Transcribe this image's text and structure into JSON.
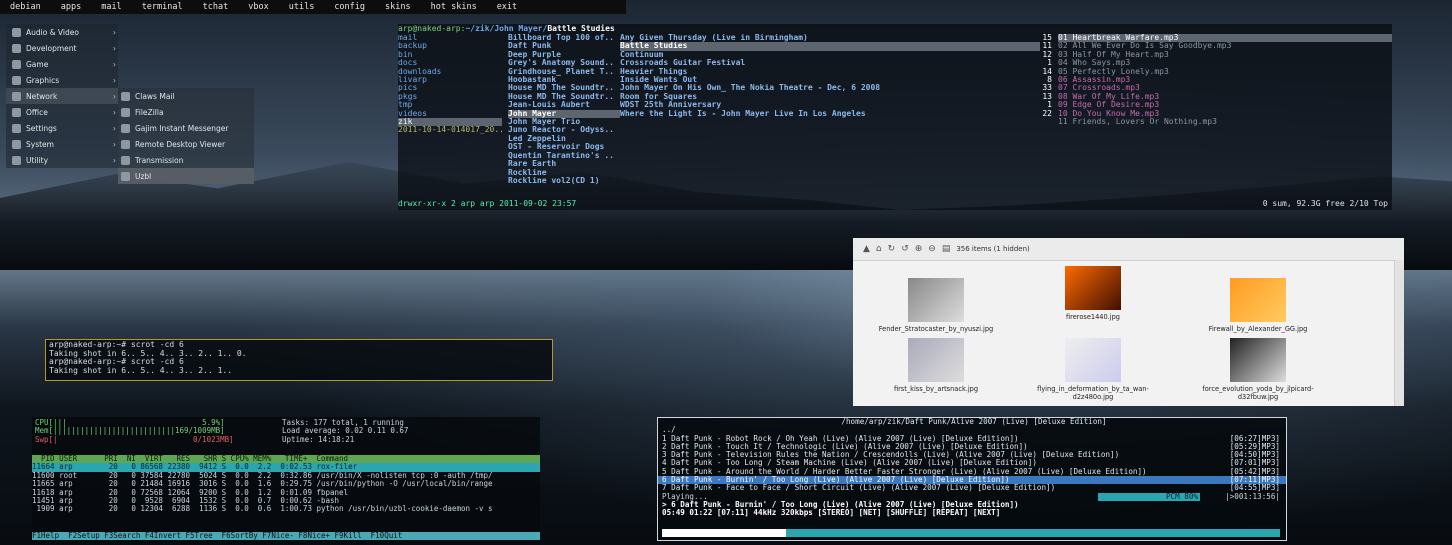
{
  "topbar": [
    "debian",
    "apps",
    "mail",
    "terminal",
    "tchat",
    "vbox",
    "utils",
    "config",
    "skins",
    "hot skins",
    "exit"
  ],
  "menu": [
    {
      "label": "Audio & Video",
      "icon": "music-icon"
    },
    {
      "label": "Development",
      "icon": "code-icon"
    },
    {
      "label": "Game",
      "icon": "gamepad-icon"
    },
    {
      "label": "Graphics",
      "icon": "graphics-icon"
    },
    {
      "label": "Network",
      "icon": "network-icon"
    },
    {
      "label": "Office",
      "icon": "office-icon"
    },
    {
      "label": "Settings",
      "icon": "settings-icon"
    },
    {
      "label": "System",
      "icon": "system-icon"
    },
    {
      "label": "Utility",
      "icon": "utility-icon"
    }
  ],
  "submenu": [
    "Claws Mail",
    "FileZilla",
    "Gajim Instant Messenger",
    "Remote Desktop Viewer",
    "Transmission",
    "Uzbl"
  ],
  "ranger": {
    "path_user": "arp@naked-arp:",
    "path": "~/zik/John Mayer/",
    "path_sel": "Battle Studies",
    "col1": [
      "mail",
      "backup",
      "bin",
      "docs",
      "downloads",
      "livarp",
      "pics",
      "pkgs",
      "tmp",
      "videos",
      "zik",
      "2011-10-14-014017_20.."
    ],
    "col2": [
      "Billboard Top 100 of..",
      "Daft Punk",
      "Deep Purple",
      "Grey's Anatomy Sound..",
      "Grindhouse_ Planet T..",
      "Hoobastank",
      "House MD The Soundtr..",
      "House MD The Soundtr..",
      "Jean-Louis Aubert",
      "John Mayer",
      "John Mayer Trio",
      "Juno Reactor - Odyss..",
      "Led Zeppelin",
      "OST - Reservoir Dogs",
      "Quentin Tarantino's ..",
      "Rare Earth",
      "Rockline",
      "Rockline vol2(CD 1)"
    ],
    "col3": [
      "Any Given Thursday (Live in Birmingham)",
      "Battle Studies",
      "Continuum",
      "Crossroads Guitar Festival",
      "Heavier Things",
      "Inside Wants Out",
      "John Mayer On His Own_ The Nokia Theatre - Dec, 6 2008",
      "Room for Squares",
      "WDST 25th Anniversary",
      "Where the Light Is - John Mayer Live In Los Angeles"
    ],
    "col3n": [
      "15",
      "11",
      "12",
      "1",
      "14",
      "8",
      "33",
      "13",
      "1",
      "22"
    ],
    "col4": [
      "01 Heartbreak Warfare.mp3",
      "02 All We Ever Do Is Say Goodbye.mp3",
      "03 Half Of My Heart.mp3",
      "04 Who Says.mp3",
      "05 Perfectly Lonely.mp3",
      "06 Assassin.mp3",
      "07 Crossroads.mp3",
      "08 War Of My Life.mp3",
      "09 Edge Of Desire.mp3",
      "10 Do You Know Me.mp3",
      "11 Friends, Lovers Or Nothing.mp3"
    ],
    "status_left": "drwxr-xr-x 2 arp arp 2011-09-02 23:57",
    "status_right": "0 sum, 92.3G free  2/10  Top"
  },
  "terminal": [
    "arp@naked-arp:~# scrot -cd 6",
    "Taking shot in 6.. 5.. 4.. 3.. 2.. 1.. 0.",
    "arp@naked-arp:~# scrot -cd 6",
    "Taking shot in 6.. 5.. 4.. 3.. 2.. 1.."
  ],
  "htop": {
    "cpu": "CPU[|||                              5.9%]",
    "mem": "Mem[|||||||||||||||||||||||||||169/1009MB]",
    "swp": "Swp[|                              0/1023MB]",
    "tasks": "Tasks: 177 total, 1 running",
    "load": "Load average: 0.02 0.11 0.67",
    "uptime": "Uptime: 14:18:21",
    "header": "  PID USER      PRI  NI  VIRT   RES   SHR S CPU% MEM%   TIME+  Command",
    "rows": [
      "11664 arp        20   0 86568 22380  9412 S  0.0  2.2  0:02.53 rox-filer",
      "11600 root       20   0 37584 22780  5024 S  0.0  2.2  0:32.86 /usr/bin/X -nolisten tcp :0 -auth /tmp/",
      "11665 arp        20   0 21484 16916  3016 S  0.0  1.6  0:29.75 /usr/bin/python -O /usr/local/bin/range",
      "11618 arp        20   0 72568 12064  9200 S  0.0  1.2  0:01.09 fbpanel",
      "11451 arp        20   0  9528  6904  1532 S  0.0  0.7  0:00.62 -bash",
      " 1909 arp        20   0 12304  6288  1136 S  0.0  0.6  1:00.73 python /usr/bin/uzbl-cookie-daemon -v s"
    ],
    "fkeys": "F1Help  F2Setup F3Search F4Invert F5Tree  F6SortBy F7Nice- F8Nice+ F9Kill  F10Quit"
  },
  "filemanager": {
    "count": "356 items (1 hidden)",
    "files": [
      "Fender_Stratocaster_by_nyuszi.jpg",
      "firerose1440.jpg",
      "Firewall_by_Alexander_GG.jpg",
      "first_kiss_by_artsnack.jpg",
      "flying_in_deformation_by_ta_wan-d2z480o.jpg",
      "force_evolution_yoda_by_jlpicard-d32fbuw.jpg"
    ]
  },
  "ncmpcpp": {
    "path": "/home/arp/zik/Daft Punk/Alive 2007 (Live) [Deluxe Edition]",
    "up": "../",
    "tracks": [
      {
        "t": "1 Daft Punk - Robot Rock / Oh Yeah (Live) (Alive 2007 (Live) [Deluxe Edition])",
        "d": "[06:27]MP3]"
      },
      {
        "t": "2 Daft Punk - Touch It / Technologic (Live) (Alive 2007 (Live) [Deluxe Edition])",
        "d": "[05:29]MP3]"
      },
      {
        "t": "3 Daft Punk - Television Rules the Nation / Crescendolls (Live) (Alive 2007 (Live) [Deluxe Edition])",
        "d": "[04:50]MP3]"
      },
      {
        "t": "4 Daft Punk - Too Long / Steam Machine (Live) (Alive 2007 (Live) [Deluxe Edition])",
        "d": "[07:01]MP3]"
      },
      {
        "t": "5 Daft Punk - Around the World / Harder Better Faster Stronger (Live) (Alive 2007 (Live) [Deluxe Edition])",
        "d": "[05:42]MP3]"
      },
      {
        "t": "6 Daft Punk - Burnin' / Too Long (Live) (Alive 2007 (Live) [Deluxe Edition])",
        "d": "[07:11]MP3]"
      },
      {
        "t": "7 Daft Punk - Face to Face / Short Circuit (Live) (Alive 2007 (Live) [Deluxe Edition])",
        "d": "[04:55]MP3]"
      }
    ],
    "playing": "Playing...",
    "pcm": "PCM  80%",
    "total": "|>001:13:56|",
    "now": "> 6 Daft Punk - Burnin' / Too Long (Live) (Alive 2007 (Live) [Deluxe Edition])",
    "info": "05:49 01:22 [07:11]   44kHz  320kbps [STEREO] [NET] [SHUFFLE] [REPEAT] [NEXT]",
    "progress": 0.2
  }
}
